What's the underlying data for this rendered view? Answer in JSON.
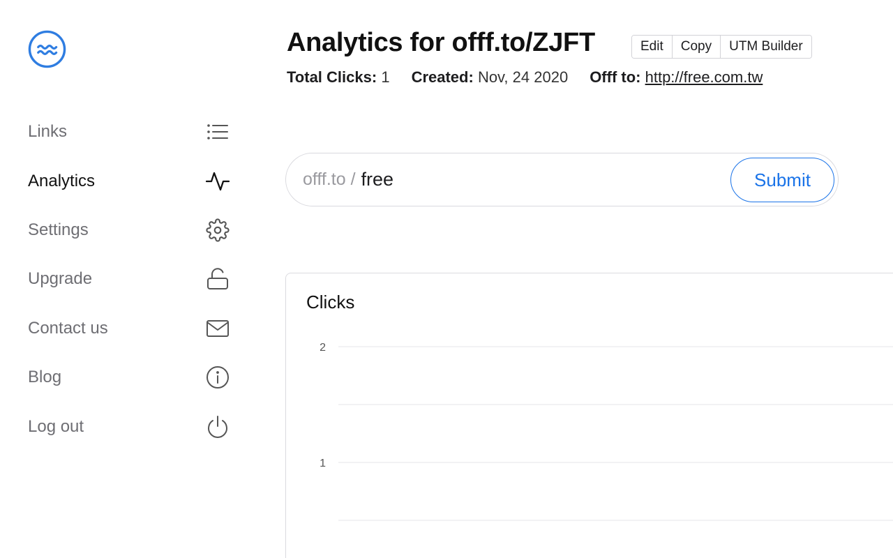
{
  "sidebar": {
    "items": [
      {
        "label": "Links",
        "icon": "list-icon"
      },
      {
        "label": "Analytics",
        "icon": "activity-icon",
        "active": true
      },
      {
        "label": "Settings",
        "icon": "gear-icon"
      },
      {
        "label": "Upgrade",
        "icon": "unlock-icon"
      },
      {
        "label": "Contact us",
        "icon": "mail-icon"
      },
      {
        "label": "Blog",
        "icon": "info-icon"
      },
      {
        "label": "Log out",
        "icon": "power-icon"
      }
    ]
  },
  "header": {
    "title": "Analytics for offf.to/ZJFT",
    "buttons": {
      "edit": "Edit",
      "copy": "Copy",
      "utm": "UTM Builder"
    },
    "meta": {
      "total_clicks_label": "Total Clicks:",
      "total_clicks_value": "1",
      "created_label": "Created:",
      "created_value": "Nov, 24 2020",
      "target_label": "Offf to:",
      "target_value": "http://free.com.tw"
    }
  },
  "search": {
    "prefix": "offf.to /",
    "value": "free",
    "submit_label": "Submit"
  },
  "colors": {
    "accent": "#1a73e8",
    "logo": "#2f7de1"
  },
  "chart_data": {
    "type": "line",
    "title": "Clicks",
    "y_ticks": [
      "2",
      "1"
    ],
    "ylim": [
      0,
      2
    ],
    "grid": true,
    "series": []
  }
}
